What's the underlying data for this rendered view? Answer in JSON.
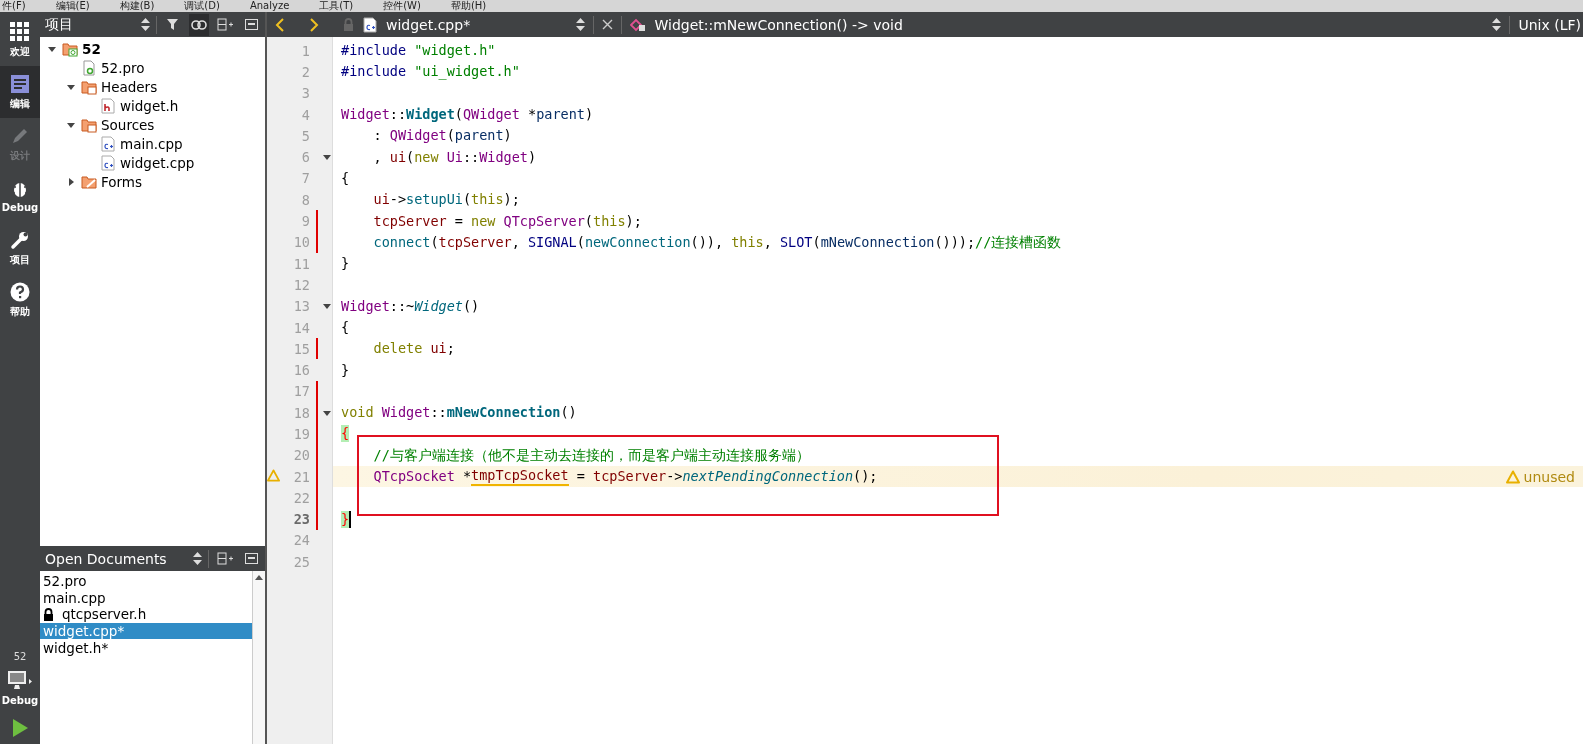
{
  "menu_bar": [
    "件(F)",
    "编辑(E)",
    "构建(B)",
    "调试(D)",
    "Analyze",
    "工具(T)",
    "控件(W)",
    "帮助(H)"
  ],
  "mode_bar": {
    "items": [
      {
        "label": "欢迎",
        "kind": "grid",
        "selected": false,
        "disabled": false
      },
      {
        "label": "编辑",
        "kind": "edit",
        "selected": true,
        "disabled": false
      },
      {
        "label": "设计",
        "kind": "pen",
        "selected": false,
        "disabled": true
      },
      {
        "label": "Debug",
        "kind": "bug",
        "selected": false,
        "disabled": false
      },
      {
        "label": "项目",
        "kind": "wrench",
        "selected": false,
        "disabled": false
      },
      {
        "label": "帮助",
        "kind": "help",
        "selected": false,
        "disabled": false
      }
    ],
    "target": {
      "project": "52",
      "label": "Debug"
    }
  },
  "project_panel": {
    "title": "项目",
    "tree": [
      {
        "label": "52",
        "kind": "project",
        "expanded": true,
        "children": [
          {
            "label": "52.pro",
            "kind": "pro"
          },
          {
            "label": "Headers",
            "kind": "folder-h",
            "expanded": true,
            "children": [
              {
                "label": "widget.h",
                "kind": "h"
              }
            ]
          },
          {
            "label": "Sources",
            "kind": "folder-cpp",
            "expanded": true,
            "children": [
              {
                "label": "main.cpp",
                "kind": "cpp"
              },
              {
                "label": "widget.cpp",
                "kind": "cpp"
              }
            ]
          },
          {
            "label": "Forms",
            "kind": "folder-form",
            "expanded": false
          }
        ]
      }
    ]
  },
  "open_documents": {
    "title": "Open Documents",
    "items": [
      {
        "label": "52.pro",
        "selected": false,
        "locked": false
      },
      {
        "label": "main.cpp",
        "selected": false,
        "locked": false
      },
      {
        "label": "qtcpserver.h",
        "selected": false,
        "locked": true
      },
      {
        "label": "widget.cpp*",
        "selected": true,
        "locked": false
      },
      {
        "label": "widget.h*",
        "selected": false,
        "locked": false
      }
    ]
  },
  "editor": {
    "file": "widget.cpp*",
    "symbol": "Widget::mNewConnection() -> void",
    "line_ending": "Unix (LF)",
    "lines": [
      {
        "number": "1",
        "tokens": [
          {
            "text": "#include ",
            "kind": "pp"
          },
          {
            "text": "\"widget.h\"",
            "kind": "str"
          }
        ]
      },
      {
        "number": "2",
        "tokens": [
          {
            "text": "#include ",
            "kind": "pp"
          },
          {
            "text": "\"ui_widget.h\"",
            "kind": "str"
          }
        ]
      },
      {
        "number": "3"
      },
      {
        "number": "4",
        "tokens": [
          {
            "text": "Widget",
            "kind": "type"
          },
          {
            "text": "::",
            "kind": "plain"
          },
          {
            "text": "Widget",
            "kind": "decl"
          },
          {
            "text": "(",
            "kind": "plain"
          },
          {
            "text": "QWidget",
            "kind": "type"
          },
          {
            "text": " *",
            "kind": "plain"
          },
          {
            "text": "parent",
            "kind": "param"
          },
          {
            "text": ")",
            "kind": "plain"
          }
        ]
      },
      {
        "number": "5",
        "tokens": [
          {
            "text": "    : ",
            "kind": "plain"
          },
          {
            "text": "QWidget",
            "kind": "type"
          },
          {
            "text": "(",
            "kind": "plain"
          },
          {
            "text": "parent",
            "kind": "param"
          },
          {
            "text": ")",
            "kind": "plain"
          }
        ]
      },
      {
        "number": "6",
        "foldable": true,
        "tokens": [
          {
            "text": "    , ",
            "kind": "plain"
          },
          {
            "text": "ui",
            "kind": "member"
          },
          {
            "text": "(",
            "kind": "plain"
          },
          {
            "text": "new ",
            "kind": "kw"
          },
          {
            "text": "Ui",
            "kind": "type"
          },
          {
            "text": "::",
            "kind": "plain"
          },
          {
            "text": "Widget",
            "kind": "type"
          },
          {
            "text": ")",
            "kind": "plain"
          }
        ]
      },
      {
        "number": "7",
        "tokens": [
          {
            "text": "{",
            "kind": "plain"
          }
        ]
      },
      {
        "number": "8",
        "tokens": [
          {
            "text": "    ui",
            "kind": "member"
          },
          {
            "text": "->",
            "kind": "plain"
          },
          {
            "text": "setupUi",
            "kind": "call"
          },
          {
            "text": "(",
            "kind": "plain"
          },
          {
            "text": "this",
            "kind": "kw"
          },
          {
            "text": ");",
            "kind": "plain"
          }
        ]
      },
      {
        "number": "9",
        "changed": true,
        "tokens": [
          {
            "text": "    tcpServer",
            "kind": "member"
          },
          {
            "text": " = ",
            "kind": "plain"
          },
          {
            "text": "new ",
            "kind": "kw"
          },
          {
            "text": "QTcpServer",
            "kind": "type"
          },
          {
            "text": "(",
            "kind": "plain"
          },
          {
            "text": "this",
            "kind": "kw"
          },
          {
            "text": ");",
            "kind": "plain"
          }
        ]
      },
      {
        "number": "10",
        "changed": true,
        "tokens": [
          {
            "text": "    connect",
            "kind": "call"
          },
          {
            "text": "(",
            "kind": "plain"
          },
          {
            "text": "tcpServer",
            "kind": "member"
          },
          {
            "text": ", ",
            "kind": "plain"
          },
          {
            "text": "SIGNAL",
            "kind": "macro"
          },
          {
            "text": "(",
            "kind": "plain"
          },
          {
            "text": "newConnection",
            "kind": "call"
          },
          {
            "text": "()), ",
            "kind": "plain"
          },
          {
            "text": "this",
            "kind": "kw"
          },
          {
            "text": ", ",
            "kind": "plain"
          },
          {
            "text": "SLOT",
            "kind": "macro"
          },
          {
            "text": "(",
            "kind": "plain"
          },
          {
            "text": "mNewConnection",
            "kind": "param"
          },
          {
            "text": "()));",
            "kind": "plain"
          },
          {
            "text": "//连接槽函数",
            "kind": "comment"
          }
        ]
      },
      {
        "number": "11",
        "tokens": [
          {
            "text": "}",
            "kind": "plain"
          }
        ]
      },
      {
        "number": "12"
      },
      {
        "number": "13",
        "foldable": true,
        "tokens": [
          {
            "text": "Widget",
            "kind": "type"
          },
          {
            "text": "::~",
            "kind": "plain"
          },
          {
            "text": "Widget",
            "kind": "virt"
          },
          {
            "text": "()",
            "kind": "plain"
          }
        ]
      },
      {
        "number": "14",
        "tokens": [
          {
            "text": "{",
            "kind": "plain"
          }
        ]
      },
      {
        "number": "15",
        "changed": true,
        "tokens": [
          {
            "text": "    delete ",
            "kind": "kw"
          },
          {
            "text": "ui",
            "kind": "member"
          },
          {
            "text": ";",
            "kind": "plain"
          }
        ]
      },
      {
        "number": "16",
        "tokens": [
          {
            "text": "}",
            "kind": "plain"
          }
        ]
      },
      {
        "number": "17",
        "changed": true
      },
      {
        "number": "18",
        "changed": true,
        "foldable": true,
        "tokens": [
          {
            "text": "void ",
            "kind": "kw"
          },
          {
            "text": "Widget",
            "kind": "type"
          },
          {
            "text": "::",
            "kind": "plain"
          },
          {
            "text": "mNewConnection",
            "kind": "decl"
          },
          {
            "text": "()",
            "kind": "plain"
          }
        ]
      },
      {
        "number": "19",
        "changed": true,
        "tokens": [
          {
            "text": "{",
            "kind": "brace"
          }
        ]
      },
      {
        "number": "20",
        "changed": true,
        "boxed": true,
        "tokens": [
          {
            "text": "    //与客户端连接（他不是主动去连接的，而是客户端主动连接服务端）",
            "kind": "comment"
          }
        ]
      },
      {
        "number": "21",
        "changed": true,
        "boxed": true,
        "warning": "unused",
        "tokens": [
          {
            "text": "    QTcpSocket",
            "kind": "type"
          },
          {
            "text": " *",
            "kind": "plain"
          },
          {
            "text": "tmpTcpSocket",
            "kind": "warnvar"
          },
          {
            "text": " = ",
            "kind": "plain"
          },
          {
            "text": "tcpServer",
            "kind": "member"
          },
          {
            "text": "->",
            "kind": "plain"
          },
          {
            "text": "nextPendingConnection",
            "kind": "virt"
          },
          {
            "text": "();",
            "kind": "plain"
          }
        ]
      },
      {
        "number": "22",
        "changed": true,
        "boxed": true
      },
      {
        "number": "23",
        "changed": true,
        "current": true,
        "tokens": [
          {
            "text": "}",
            "kind": "brace"
          }
        ]
      },
      {
        "number": "24"
      },
      {
        "number": "25"
      }
    ]
  }
}
